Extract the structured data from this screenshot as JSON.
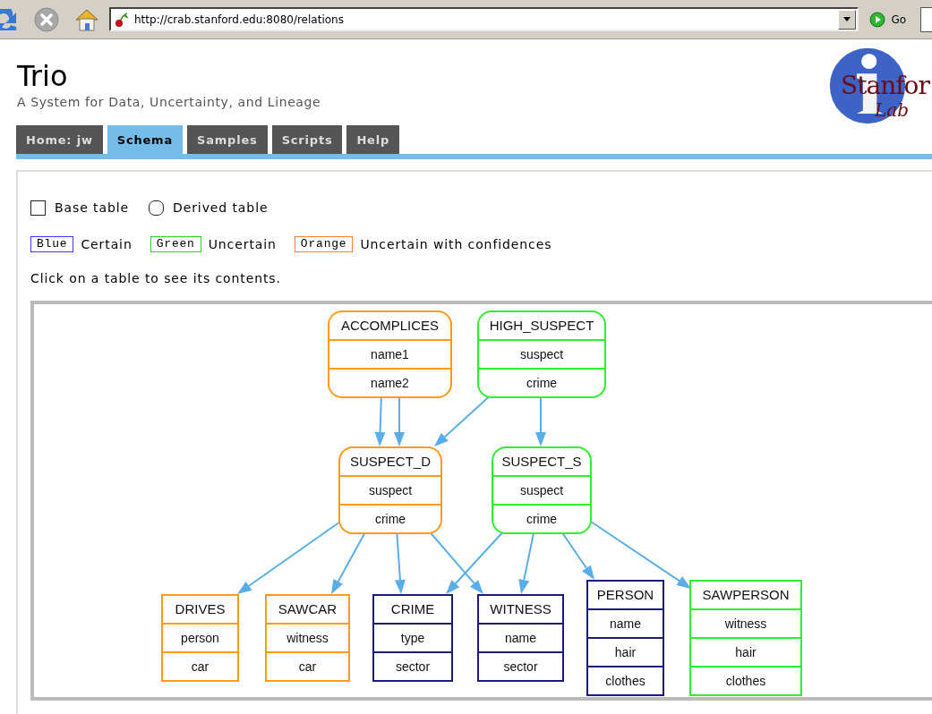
{
  "browser": {
    "url": "http://crab.stanford.edu:8080/relations",
    "go_label": "Go"
  },
  "site": {
    "title": "Trio",
    "subtitle": "A System for Data, Uncertainty, and Lineage",
    "logo_text": "Stanfor",
    "logo_subtext": "Lab"
  },
  "tabs": [
    {
      "label": "Home: jw",
      "selected": false
    },
    {
      "label": "Schema",
      "selected": true
    },
    {
      "label": "Samples",
      "selected": false
    },
    {
      "label": "Scripts",
      "selected": false
    },
    {
      "label": "Help",
      "selected": false
    }
  ],
  "legend": {
    "shapes": [
      {
        "kind": "square",
        "label": "Base table"
      },
      {
        "kind": "round",
        "label": "Derived table"
      }
    ],
    "colors": [
      {
        "name": "Blue",
        "color": "#3b3bf5",
        "label": "Certain"
      },
      {
        "name": "Green",
        "color": "#2ccf2c",
        "label": "Uncertain"
      },
      {
        "name": "Orange",
        "color": "#f57f3b",
        "label": "Uncertain with confidences"
      }
    ]
  },
  "hint": "Click on a table to see its contents.",
  "diagram": {
    "nodes": [
      {
        "name": "ACCOMPLICES",
        "kind": "derived",
        "color": "#ff9a1f",
        "fields": [
          "name1",
          "name2"
        ]
      },
      {
        "name": "HIGH_SUSPECT",
        "kind": "derived",
        "color": "#2ef02e",
        "fields": [
          "suspect",
          "crime"
        ]
      },
      {
        "name": "SUSPECT_D",
        "kind": "derived",
        "color": "#ff9a1f",
        "fields": [
          "suspect",
          "crime"
        ]
      },
      {
        "name": "SUSPECT_S",
        "kind": "derived",
        "color": "#2ef02e",
        "fields": [
          "suspect",
          "crime"
        ]
      },
      {
        "name": "DRIVES",
        "kind": "base",
        "color": "#ff9a1f",
        "fields": [
          "person",
          "car"
        ]
      },
      {
        "name": "SAWCAR",
        "kind": "base",
        "color": "#ff9a1f",
        "fields": [
          "witness",
          "car"
        ]
      },
      {
        "name": "CRIME",
        "kind": "base",
        "color": "#1c1c7a",
        "fields": [
          "type",
          "sector"
        ]
      },
      {
        "name": "WITNESS",
        "kind": "base",
        "color": "#1c1c7a",
        "fields": [
          "name",
          "sector"
        ]
      },
      {
        "name": "PERSON",
        "kind": "base",
        "color": "#1c1c7a",
        "fields": [
          "name",
          "hair",
          "clothes"
        ]
      },
      {
        "name": "SAWPERSON",
        "kind": "base",
        "color": "#2ef02e",
        "fields": [
          "witness",
          "hair",
          "clothes"
        ]
      }
    ]
  }
}
